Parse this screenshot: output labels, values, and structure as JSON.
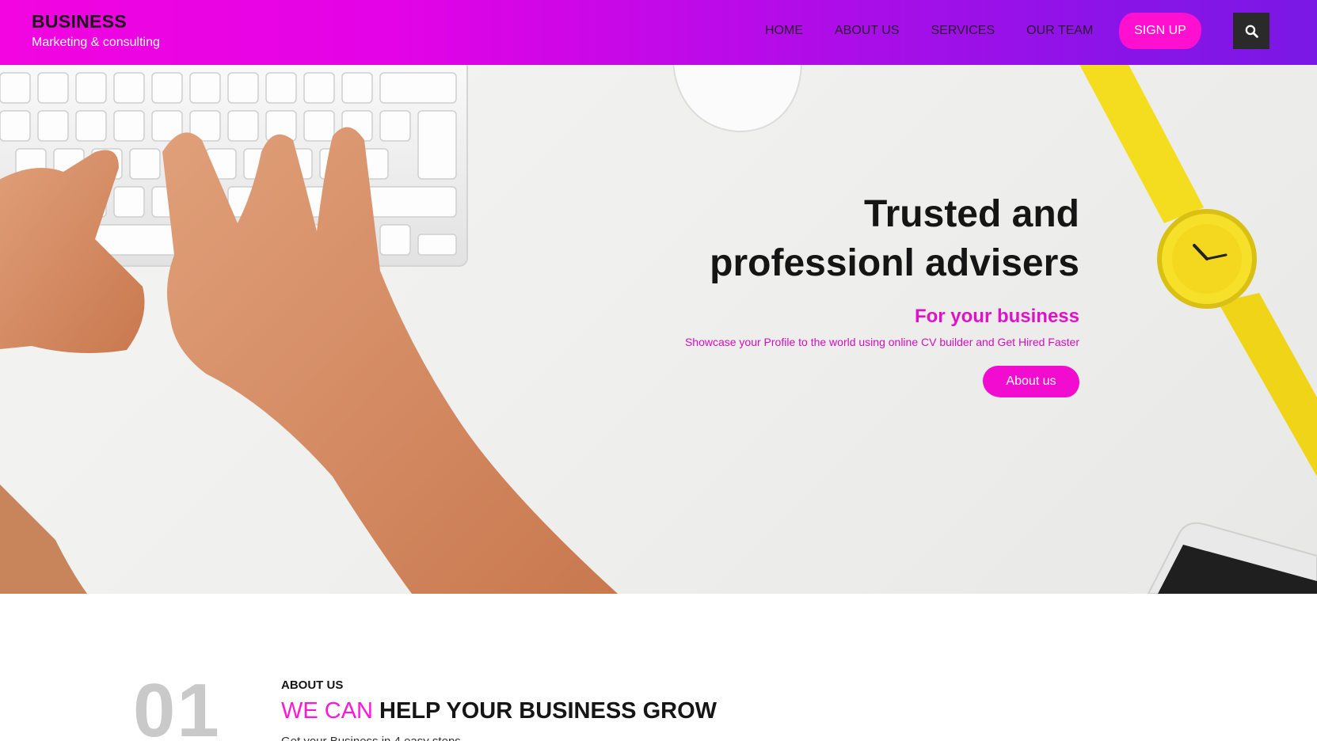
{
  "header": {
    "brand_title": "BUSINESS",
    "brand_subtitle": "Marketing & consulting",
    "nav": [
      {
        "label": "HOME"
      },
      {
        "label": "ABOUT US"
      },
      {
        "label": "SERVICES"
      },
      {
        "label": "OUR TEAM"
      }
    ],
    "signup_label": "SIGN UP",
    "search_icon": "search-icon"
  },
  "hero": {
    "title_line1": "Trusted and",
    "title_line2": "professionl advisers",
    "subtitle": "For your business",
    "description": "Showcase your Profile to the world using online CV builder and Get Hired Faster",
    "button_label": "About us"
  },
  "about": {
    "step_number": "01",
    "label": "ABOUT US",
    "heading_accent": "WE CAN",
    "heading_rest": " HELP YOUR BUSINESS GROW",
    "steps_text": "Get your Business in 4 easy steps"
  },
  "colors": {
    "accent": "#ff18d6",
    "header_gradient_start": "#f205e0",
    "header_gradient_end": "#7a18e6",
    "dark": "#151515"
  }
}
